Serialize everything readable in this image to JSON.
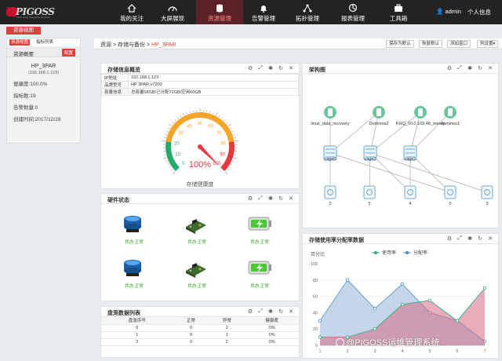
{
  "logo": {
    "brand": "PIGOSS",
    "sub": "Technology Integration Services"
  },
  "nav": {
    "items": [
      {
        "label": "我的关注",
        "icon": "home-icon"
      },
      {
        "label": "大屏展现",
        "icon": "dashboard-icon"
      },
      {
        "label": "资源管理",
        "icon": "database-icon",
        "active": true
      },
      {
        "label": "告警管理",
        "icon": "bell-icon"
      },
      {
        "label": "拓扑管理",
        "icon": "topology-icon"
      },
      {
        "label": "报表管理",
        "icon": "report-icon"
      },
      {
        "label": "工具箱",
        "icon": "toolbox-icon"
      }
    ],
    "user": "admin",
    "center": "个人信息"
  },
  "left": {
    "view_button": "资源视图",
    "tab_view": "资源视图",
    "tab_metrics": "指标列表",
    "overview_title": "资源概要",
    "config_button": "配置",
    "name": "HP_3PAR",
    "ip": "(192.168.1.123)",
    "health": "健康度:100.0%",
    "metrics": "指标数:19",
    "alarms": "告警数量:0",
    "created": "创建时间:2017/12/28"
  },
  "breadcrumb": {
    "root": "资源",
    "sep": ">",
    "mid": "存储与备份",
    "current": "HP_3PAR"
  },
  "toolbar": {
    "save": "保存为默认",
    "restore": "恢复默认",
    "add": "添加窗口",
    "columns": "列设置▾"
  },
  "storage": {
    "title": "存储信息概览",
    "rows": [
      {
        "k": "IP地址",
        "v": "192.168.1.123"
      },
      {
        "k": "品牌型号",
        "v": "HP 3PAR v7200"
      },
      {
        "k": "容量信息",
        "v": "总容量58GB/已分配72GB/空闲60GB"
      }
    ],
    "gauge": {
      "value": 100,
      "value_label": "100%",
      "caption": "存储健康度",
      "ticks": [
        "0",
        "10",
        "20",
        "30",
        "40",
        "50",
        "60",
        "70",
        "80",
        "90",
        "100"
      ]
    }
  },
  "arch": {
    "title": "架构图",
    "hosts": [
      "linux_data_recovery",
      "Dominos2",
      "KHQ_10.0.169.48_merey",
      "dominos1"
    ],
    "cages": [
      "cage0",
      "cage2",
      "cage1"
    ],
    "disks": [
      "2",
      "5",
      "4",
      "0",
      "3"
    ]
  },
  "hardware": {
    "title": "硬件状态",
    "items": [
      {
        "icon": "disk-icon",
        "status": "状态:正常"
      },
      {
        "icon": "board-icon",
        "status": "状态:正常"
      },
      {
        "icon": "battery-icon",
        "status": "状态:正常"
      },
      {
        "icon": "disk-icon",
        "status": "状态:正常"
      },
      {
        "icon": "board-icon",
        "status": "状态:正常"
      },
      {
        "icon": "battery-icon",
        "status": "状态:正常"
      }
    ]
  },
  "disks": {
    "title": "盘笼数据列表",
    "headers": [
      "盘笼序号",
      "正常",
      "异常",
      "健康度"
    ],
    "rows": [
      [
        "0",
        "0",
        "2",
        "0%"
      ],
      [
        "1",
        "0",
        "1",
        "0%"
      ],
      [
        "2",
        "0",
        "2",
        "0%"
      ]
    ]
  },
  "usage": {
    "title": "存储使用率分配率数据"
  },
  "colors": {
    "accent": "#e53e3e",
    "nav_bg": "#232323",
    "usage": "#2aa87e",
    "alloc": "#4a90c8"
  },
  "chart_data": {
    "type": "area",
    "ylabel": "百分比",
    "ylim": [
      0,
      100
    ],
    "yticks": [
      0,
      20,
      40,
      60,
      80,
      100
    ],
    "categories": [
      "1",
      "2",
      "3",
      "4",
      "5",
      "6",
      "7"
    ],
    "series": [
      {
        "name": "使用率",
        "values": [
          10,
          10,
          20,
          50,
          55,
          30,
          70
        ]
      },
      {
        "name": "分配率",
        "values": [
          30,
          80,
          45,
          75,
          40,
          30,
          5
        ]
      }
    ],
    "legend": "top"
  },
  "watermark": "@PIGOSS运维管理系统"
}
